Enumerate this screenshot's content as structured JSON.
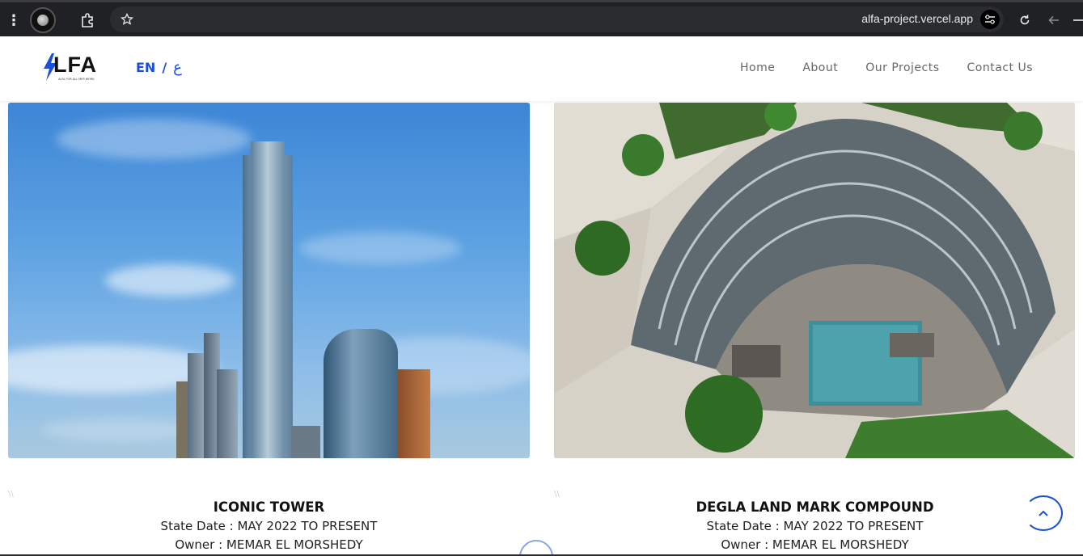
{
  "browser": {
    "url": "alfa-project.vercel.app"
  },
  "header": {
    "logo_text": "LFA",
    "logo_tagline": "ALFA FOR ALL MEP WORK",
    "lang_en": "EN",
    "lang_separator": "/",
    "lang_ar": "ع",
    "nav": [
      "Home",
      "About",
      "Our Projects",
      "Contact Us"
    ]
  },
  "projects": [
    {
      "title": "ICONIC TOWER",
      "start": "State Date : MAY 2022 TO PRESENT",
      "owner": "Owner : MEMAR EL MORSHEDY"
    },
    {
      "title": "DEGLA LAND MARK COMPOUND",
      "start": "State Date : MAY 2022 TO PRESENT",
      "owner": "Owner : MEMAR EL MORSHEDY"
    }
  ],
  "colors": {
    "accent": "#1a4fd6",
    "chrome": "#202124"
  }
}
